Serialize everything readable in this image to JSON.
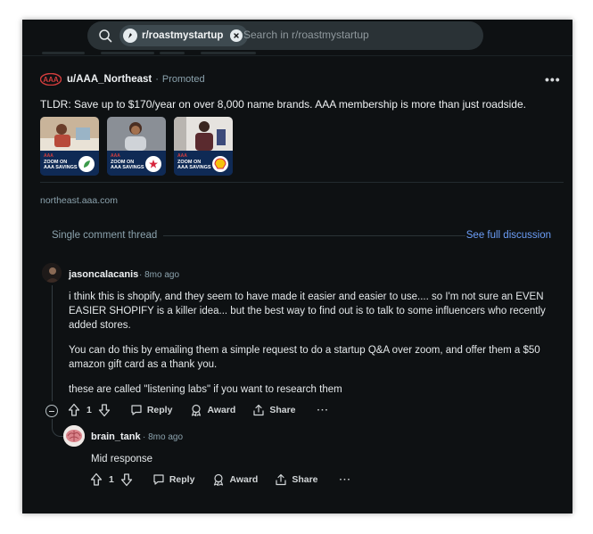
{
  "search": {
    "community_chip": "r/roastmystartup",
    "placeholder": "Search in r/roastmystartup"
  },
  "ad": {
    "username": "u/AAA_Northeast",
    "promoted_label": "Promoted",
    "text": "TLDR: Save up to $170/year on over 8,000 name brands. AAA membership is more than just roadside.",
    "cards": [
      {
        "zoom_line1": "ZOOM ON",
        "zoom_line2": "AAA SAVINGS"
      },
      {
        "zoom_line1": "ZOOM ON",
        "zoom_line2": "AAA SAVINGS"
      },
      {
        "zoom_line1": "ZOOM ON",
        "zoom_line2": "AAA SAVINGS"
      }
    ],
    "url": "northeast.aaa.com"
  },
  "thread": {
    "label": "Single comment thread",
    "see_full": "See full discussion"
  },
  "comments": [
    {
      "username": "jasoncalacanis",
      "time": "8mo ago",
      "paragraphs": [
        "i think this is shopify, and they seem to have made it easier and easier to use.... so I'm not sure an EVEN EASIER SHOPIFY is a killer idea... but the best way to find out is to talk to some influencers who recently added stores.",
        "You can do this by emailing them a simple request to do a startup Q&A over zoom, and offer them a $50 amazon gift card as a thank you.",
        "these are called \"listening labs\" if you want to research them"
      ],
      "votes": "1",
      "reply_label": "Reply",
      "award_label": "Award",
      "share_label": "Share"
    },
    {
      "username": "brain_tank",
      "time": "8mo ago",
      "paragraphs": [
        "Mid response"
      ],
      "votes": "1",
      "reply_label": "Reply",
      "award_label": "Award",
      "share_label": "Share"
    }
  ],
  "colors": {
    "background": "#0e1113",
    "link": "#6c9ef8",
    "aaa_red": "#d43d3d"
  }
}
